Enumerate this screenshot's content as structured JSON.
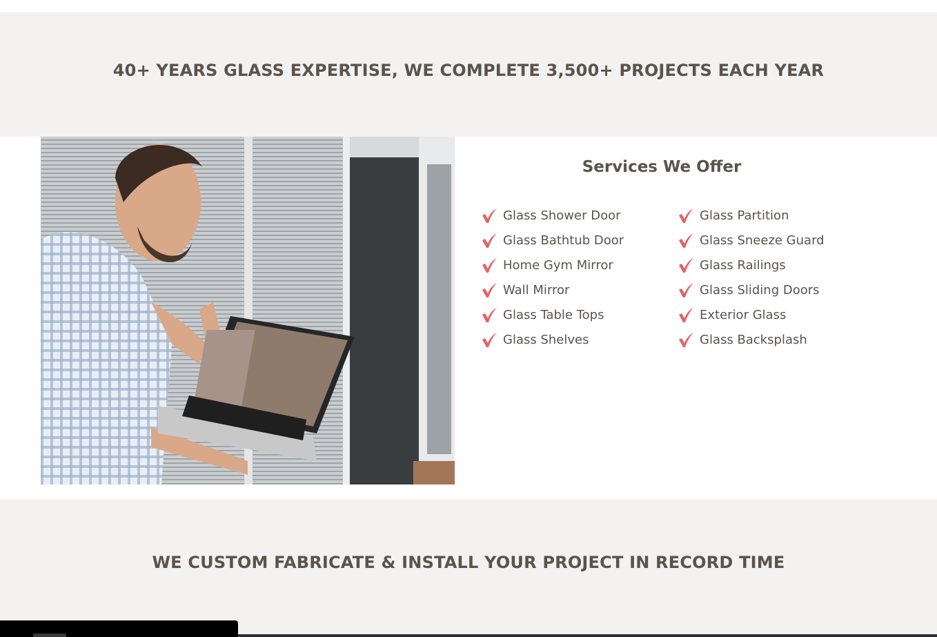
{
  "banner_top": {
    "heading": "40+ YEARS GLASS EXPERTISE, WE COMPLETE 3,500+ PROJECTS EACH YEAR"
  },
  "services": {
    "title": "Services We Offer",
    "check_color": "#e06464",
    "left_items": [
      "Glass Shower Door",
      "Glass Bathtub Door",
      "Home Gym Mirror",
      "Wall Mirror",
      "Glass Table Tops",
      "Glass Shelves"
    ],
    "right_items": [
      "Glass Partition",
      "Glass Sneeze Guard",
      "Glass Railings",
      "Glass Sliding Doors",
      "Exterior Glass",
      "Glass Backsplash"
    ]
  },
  "banner_bottom": {
    "heading": "WE CUSTOM FABRICATE & INSTALL YOUR PROJECT IN RECORD TIME"
  },
  "colors": {
    "band_background": "#f3f2f0",
    "text": "#5c534b",
    "accent": "#e06464"
  }
}
